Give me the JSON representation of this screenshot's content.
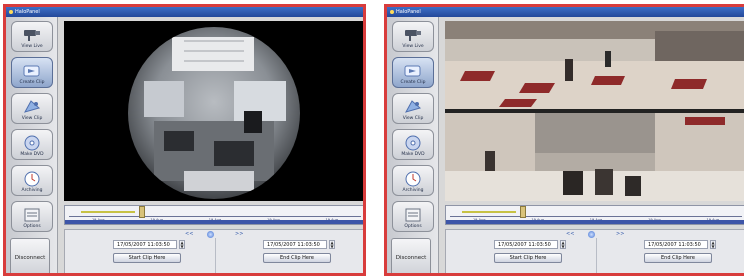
{
  "window": {
    "title": "HaloPanel"
  },
  "sidebar": {
    "items": [
      {
        "label": "View Live",
        "icon": "camera-icon"
      },
      {
        "label": "Create Clip",
        "icon": "create-clip-icon"
      },
      {
        "label": "View Clip",
        "icon": "view-clip-icon"
      },
      {
        "label": "Make DVD",
        "icon": "dvd-icon"
      },
      {
        "label": "Archiving",
        "icon": "archive-clock-icon"
      },
      {
        "label": "Options",
        "icon": "options-icon"
      }
    ]
  },
  "timeline": {
    "labels": [
      "19-Aug",
      "19-Aug",
      "19-Aug",
      "19-Aug",
      "19-Aug"
    ]
  },
  "controls": {
    "rewind": "<<",
    "forward": ">>",
    "disconnect_label": "Disconnect",
    "start_time": "17/05/2007  11:03:50",
    "end_time": "17/05/2007  11:03:50",
    "start_button": "Start Clip Here",
    "end_button": "End Clip Here"
  },
  "colors": {
    "accent": "#2a52a8",
    "border": "#d83c3c"
  }
}
